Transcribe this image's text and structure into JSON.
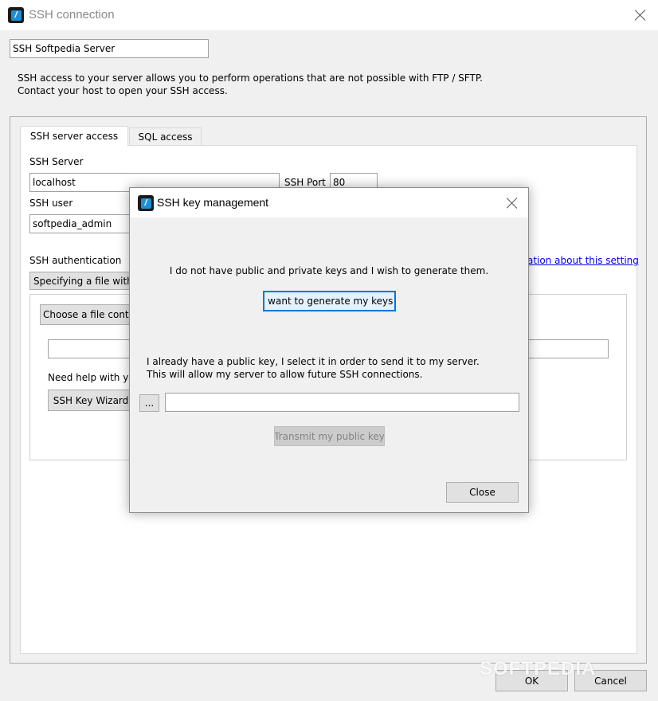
{
  "window": {
    "title": "SSH connection"
  },
  "connection_name": {
    "value": "SSH Softpedia Server"
  },
  "description": {
    "line1": "SSH access to your server allows you to perform operations that are not possible with FTP / SFTP.",
    "line2": "Contact your host to open your SSH access."
  },
  "tabs": [
    {
      "label": "SSH server access"
    },
    {
      "label": "SQL access"
    }
  ],
  "server": {
    "server_label": "SSH Server",
    "server_value": "localhost",
    "port_label": "SSH Port",
    "port_value": "80",
    "user_label": "SSH user",
    "user_value": "softpedia_admin",
    "auth_label": "SSH authentication",
    "auth_button_partial": "Specifying a file with",
    "info_link_partial": "ation about this setting",
    "choose_button_partial": "Choose a file conta",
    "help_partial": "Need help with yo",
    "wizard_button": "SSH Key Wizard"
  },
  "footer": {
    "ok": "OK",
    "cancel": "Cancel"
  },
  "dialog": {
    "title": "SSH key management",
    "generate_text": "I do not have public and private keys and I wish to generate them.",
    "generate_button": "I want to generate my keys!",
    "existing_line1": "I already have a public key, I select it in order to send it to my server.",
    "existing_line2": "This will allow my server to allow future SSH connections.",
    "browse_button": "...",
    "key_path_value": "",
    "transmit_button": "Transmit my public key",
    "close_button": "Close"
  },
  "watermark": "SOFTPEDIA",
  "colors": {
    "accent": "#0078d7",
    "app_icon": "#1e8fd6",
    "link": "#0000ee"
  }
}
